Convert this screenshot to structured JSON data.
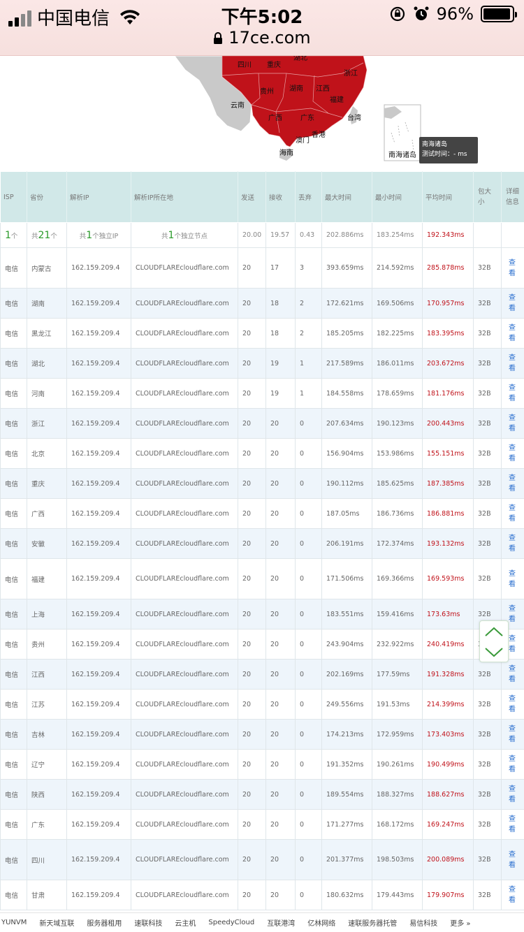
{
  "status_bar": {
    "carrier": "中国电信",
    "time": "下午5:02",
    "battery": "96%",
    "url": "17ce.com",
    "battery_level": 0.96
  },
  "map": {
    "labels": [
      "四川",
      "重庆",
      "湖北",
      "浙江",
      "贵州",
      "湖南",
      "江西",
      "福建",
      "云南",
      "广西",
      "广东",
      "台湾",
      "香港",
      "澳门",
      "海南",
      "南海诸岛"
    ],
    "tooltip": {
      "title": "南海诸岛",
      "line": "测试时间：- ms"
    },
    "colors": {
      "highlight": "#c0121a",
      "land": "#c9c9c9"
    }
  },
  "table": {
    "headers": [
      "ISP",
      "省份",
      "解析IP",
      "解析IP所在地",
      "发送",
      "接收",
      "丢弃",
      "最大时间",
      "最小时间",
      "平均时间",
      "包大小",
      "详细信息"
    ],
    "summary": {
      "isp_count": "1",
      "isp_unit": "个",
      "prov_prefix": "共",
      "prov_count": "21",
      "prov_unit": "个",
      "ip_prefix": "共",
      "ip_count": "1",
      "ip_unit": "个独立IP",
      "node_prefix": "共",
      "node_count": "1",
      "node_unit": "个独立节点",
      "send": "20.00",
      "recv": "19.57",
      "lost": "0.43",
      "max": "202.886ms",
      "min": "183.254ms",
      "avg": "192.343ms"
    },
    "rows": [
      {
        "isp": "电信",
        "prov": "内蒙古",
        "ip": "162.159.209.4",
        "loc": "CLOUDFLAREcloudflare.com",
        "send": "20",
        "recv": "17",
        "lost": "3",
        "max": "393.659ms",
        "min": "214.592ms",
        "avg": "285.878ms",
        "size": "32B",
        "view": "查看"
      },
      {
        "isp": "电信",
        "prov": "湖南",
        "ip": "162.159.209.4",
        "loc": "CLOUDFLAREcloudflare.com",
        "send": "20",
        "recv": "18",
        "lost": "2",
        "max": "172.621ms",
        "min": "169.506ms",
        "avg": "170.957ms",
        "size": "32B",
        "view": "查看"
      },
      {
        "isp": "电信",
        "prov": "黑龙江",
        "ip": "162.159.209.4",
        "loc": "CLOUDFLAREcloudflare.com",
        "send": "20",
        "recv": "18",
        "lost": "2",
        "max": "185.205ms",
        "min": "182.225ms",
        "avg": "183.395ms",
        "size": "32B",
        "view": "查看"
      },
      {
        "isp": "电信",
        "prov": "湖北",
        "ip": "162.159.209.4",
        "loc": "CLOUDFLAREcloudflare.com",
        "send": "20",
        "recv": "19",
        "lost": "1",
        "max": "217.589ms",
        "min": "186.011ms",
        "avg": "203.672ms",
        "size": "32B",
        "view": "查看"
      },
      {
        "isp": "电信",
        "prov": "河南",
        "ip": "162.159.209.4",
        "loc": "CLOUDFLAREcloudflare.com",
        "send": "20",
        "recv": "19",
        "lost": "1",
        "max": "184.558ms",
        "min": "178.659ms",
        "avg": "181.176ms",
        "size": "32B",
        "view": "查看"
      },
      {
        "isp": "电信",
        "prov": "浙江",
        "ip": "162.159.209.4",
        "loc": "CLOUDFLAREcloudflare.com",
        "send": "20",
        "recv": "20",
        "lost": "0",
        "max": "207.634ms",
        "min": "190.123ms",
        "avg": "200.443ms",
        "size": "32B",
        "view": "查看"
      },
      {
        "isp": "电信",
        "prov": "北京",
        "ip": "162.159.209.4",
        "loc": "CLOUDFLAREcloudflare.com",
        "send": "20",
        "recv": "20",
        "lost": "0",
        "max": "156.904ms",
        "min": "153.986ms",
        "avg": "155.151ms",
        "size": "32B",
        "view": "查看"
      },
      {
        "isp": "电信",
        "prov": "重庆",
        "ip": "162.159.209.4",
        "loc": "CLOUDFLAREcloudflare.com",
        "send": "20",
        "recv": "20",
        "lost": "0",
        "max": "190.112ms",
        "min": "185.625ms",
        "avg": "187.385ms",
        "size": "32B",
        "view": "查看"
      },
      {
        "isp": "电信",
        "prov": "广西",
        "ip": "162.159.209.4",
        "loc": "CLOUDFLAREcloudflare.com",
        "send": "20",
        "recv": "20",
        "lost": "0",
        "max": "187.05ms",
        "min": "186.736ms",
        "avg": "186.881ms",
        "size": "32B",
        "view": "查看"
      },
      {
        "isp": "电信",
        "prov": "安徽",
        "ip": "162.159.209.4",
        "loc": "CLOUDFLAREcloudflare.com",
        "send": "20",
        "recv": "20",
        "lost": "0",
        "max": "206.191ms",
        "min": "172.374ms",
        "avg": "193.132ms",
        "size": "32B",
        "view": "查看"
      },
      {
        "isp": "电信",
        "prov": "福建",
        "ip": "162.159.209.4",
        "loc": "CLOUDFLAREcloudflare.com",
        "send": "20",
        "recv": "20",
        "lost": "0",
        "max": "171.506ms",
        "min": "169.366ms",
        "avg": "169.593ms",
        "size": "32B",
        "view": "查看"
      },
      {
        "isp": "电信",
        "prov": "上海",
        "ip": "162.159.209.4",
        "loc": "CLOUDFLAREcloudflare.com",
        "send": "20",
        "recv": "20",
        "lost": "0",
        "max": "183.551ms",
        "min": "159.416ms",
        "avg": "173.63ms",
        "size": "32B",
        "view": "查看"
      },
      {
        "isp": "电信",
        "prov": "贵州",
        "ip": "162.159.209.4",
        "loc": "CLOUDFLAREcloudflare.com",
        "send": "20",
        "recv": "20",
        "lost": "0",
        "max": "243.904ms",
        "min": "232.922ms",
        "avg": "240.419ms",
        "size": "32B",
        "view": "查看"
      },
      {
        "isp": "电信",
        "prov": "江西",
        "ip": "162.159.209.4",
        "loc": "CLOUDFLAREcloudflare.com",
        "send": "20",
        "recv": "20",
        "lost": "0",
        "max": "202.169ms",
        "min": "177.59ms",
        "avg": "191.328ms",
        "size": "32B",
        "view": "查看"
      },
      {
        "isp": "电信",
        "prov": "江苏",
        "ip": "162.159.209.4",
        "loc": "CLOUDFLAREcloudflare.com",
        "send": "20",
        "recv": "20",
        "lost": "0",
        "max": "249.556ms",
        "min": "191.53ms",
        "avg": "214.399ms",
        "size": "32B",
        "view": "查看"
      },
      {
        "isp": "电信",
        "prov": "吉林",
        "ip": "162.159.209.4",
        "loc": "CLOUDFLAREcloudflare.com",
        "send": "20",
        "recv": "20",
        "lost": "0",
        "max": "174.213ms",
        "min": "172.959ms",
        "avg": "173.403ms",
        "size": "32B",
        "view": "查看"
      },
      {
        "isp": "电信",
        "prov": "辽宁",
        "ip": "162.159.209.4",
        "loc": "CLOUDFLAREcloudflare.com",
        "send": "20",
        "recv": "20",
        "lost": "0",
        "max": "191.352ms",
        "min": "190.261ms",
        "avg": "190.499ms",
        "size": "32B",
        "view": "查看"
      },
      {
        "isp": "电信",
        "prov": "陕西",
        "ip": "162.159.209.4",
        "loc": "CLOUDFLAREcloudflare.com",
        "send": "20",
        "recv": "20",
        "lost": "0",
        "max": "189.554ms",
        "min": "188.327ms",
        "avg": "188.627ms",
        "size": "32B",
        "view": "查看"
      },
      {
        "isp": "电信",
        "prov": "广东",
        "ip": "162.159.209.4",
        "loc": "CLOUDFLAREcloudflare.com",
        "send": "20",
        "recv": "20",
        "lost": "0",
        "max": "171.277ms",
        "min": "168.172ms",
        "avg": "169.247ms",
        "size": "32B",
        "view": "查看"
      },
      {
        "isp": "电信",
        "prov": "四川",
        "ip": "162.159.209.4",
        "loc": "CLOUDFLAREcloudflare.com",
        "send": "20",
        "recv": "20",
        "lost": "0",
        "max": "201.377ms",
        "min": "198.503ms",
        "avg": "200.089ms",
        "size": "32B",
        "view": "查看"
      },
      {
        "isp": "电信",
        "prov": "甘肃",
        "ip": "162.159.209.4",
        "loc": "CLOUDFLAREcloudflare.com",
        "send": "20",
        "recv": "20",
        "lost": "0",
        "max": "180.632ms",
        "min": "179.443ms",
        "avg": "179.907ms",
        "size": "32B",
        "view": "查看"
      }
    ]
  },
  "footer": {
    "links": [
      "YUNVM",
      "新天域互联",
      "服务器租用",
      "速联科技",
      "云主机",
      "SpeedyCloud",
      "互联港湾",
      "亿林网络",
      "速联服务器托管",
      "易信科技",
      "更多 »"
    ]
  }
}
